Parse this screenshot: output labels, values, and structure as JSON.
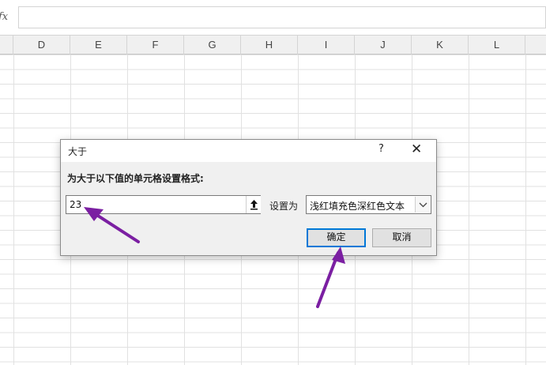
{
  "formula_bar": {
    "fx_label": "fx",
    "value": ""
  },
  "columns": [
    "D",
    "E",
    "F",
    "G",
    "H",
    "I",
    "J",
    "K",
    "L"
  ],
  "dialog": {
    "title": "大于",
    "help_label": "?",
    "close_label": "✕",
    "prompt": "为大于以下值的单元格设置格式:",
    "value": "23",
    "set_as_label": "设置为",
    "format_selected": "浅红填充色深红色文本",
    "ok_label": "确定",
    "cancel_label": "取消"
  },
  "colors": {
    "arrow": "#7b1fa2",
    "focus_border": "#0078d7"
  }
}
